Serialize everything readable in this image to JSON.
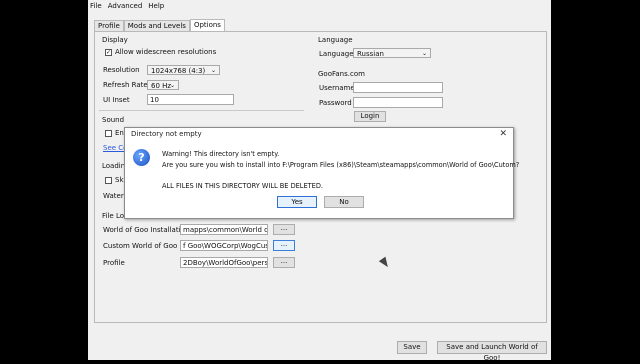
{
  "menu": [
    "File",
    "Advanced",
    "Help"
  ],
  "tabs": [
    "Profile",
    "Mods and Levels",
    "Options"
  ],
  "display": {
    "title": "Display",
    "widescreen_label": "Allow widescreen resolutions",
    "resolution_label": "Resolution",
    "resolution_value": "1024x768 (4:3)",
    "refresh_label": "Refresh Rate",
    "refresh_value": "60 Hz",
    "inset_label": "UI Inset",
    "inset_value": "10"
  },
  "sound": {
    "title": "Sound",
    "enable_label": "Ena",
    "config_link": "See Con"
  },
  "loading": {
    "title": "Loading S",
    "skip_label": "Skip",
    "watermark_label": "Waterma"
  },
  "files": {
    "title": "File Locati",
    "wog_label": "World of Goo Installation",
    "wog_value": "mapps\\common\\World of Goo",
    "custom_label": "Custom World of Goo",
    "custom_value": "f Goo\\WOGCorp\\WogCustom",
    "profile_label": "Profile",
    "profile_value": "2DBoy\\WorldOfGoo\\pers2.dat",
    "browse": "..."
  },
  "language": {
    "title": "Language",
    "label": "Language",
    "value": "Russian"
  },
  "goofans": {
    "title": "GooFans.com",
    "username_label": "Username",
    "password_label": "Password",
    "login_button": "Login"
  },
  "footer": {
    "save": "Save",
    "save_launch": "Save and Launch World of Goo!"
  },
  "dialog": {
    "title": "Directory not empty",
    "line1": "Warning! This directory isn't empty.",
    "line2": "Are you sure you wish to install into F:\\Program Files (x86)\\Steam\\steamapps\\common\\World of Goo\\Cutom?",
    "line3": "ALL FILES IN THIS DIRECTORY WILL BE DELETED.",
    "yes": "Yes",
    "no": "No",
    "icon": "question-icon"
  }
}
